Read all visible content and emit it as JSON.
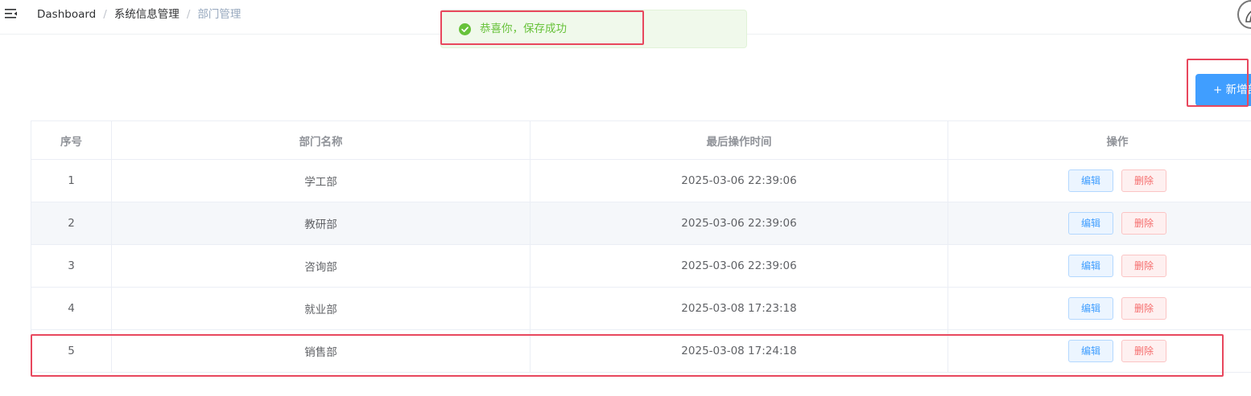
{
  "navbar": {
    "icons": {
      "menu": "hamburger-fold-icon",
      "avatar": "user-avatar"
    },
    "breadcrumb": [
      {
        "label": "Dashboard"
      },
      {
        "label": "系统信息管理"
      },
      {
        "label": "部门管理"
      }
    ],
    "separator": "/"
  },
  "toast": {
    "type": "success",
    "icon": "check-circle-icon",
    "message": "恭喜你，保存成功",
    "color": "#67c23a"
  },
  "toolbar": {
    "add_label": "+ 新增部",
    "accent": "#409eff"
  },
  "table": {
    "columns": [
      "序号",
      "部门名称",
      "最后操作时间",
      "操作"
    ],
    "rows": [
      {
        "index": "1",
        "name": "学工部",
        "time": "2025-03-06 22:39:06",
        "edit": "编辑",
        "delete": "删除"
      },
      {
        "index": "2",
        "name": "教研部",
        "time": "2025-03-06 22:39:06",
        "edit": "编辑",
        "delete": "删除"
      },
      {
        "index": "3",
        "name": "咨询部",
        "time": "2025-03-06 22:39:06",
        "edit": "编辑",
        "delete": "删除"
      },
      {
        "index": "4",
        "name": "就业部",
        "time": "2025-03-08 17:23:18",
        "edit": "编辑",
        "delete": "删除"
      },
      {
        "index": "5",
        "name": "销售部",
        "time": "2025-03-08 17:24:18",
        "edit": "编辑",
        "delete": "删除"
      }
    ]
  },
  "colors": {
    "danger": "#f56c6c",
    "annotation": "#e8475d"
  }
}
